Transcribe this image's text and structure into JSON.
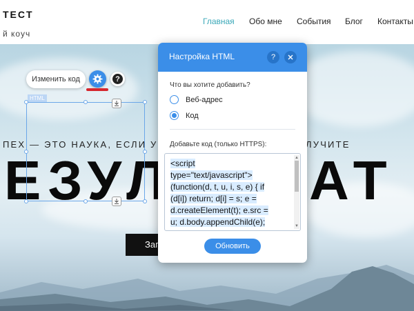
{
  "header": {
    "logo": "TECT",
    "tagline": "й коуч",
    "nav": [
      "Главная",
      "Обо мне",
      "События",
      "Блог",
      "Контакты"
    ]
  },
  "hero": {
    "line_left": "ПЕХ — ЭТО НАУКА, ЕСЛИ У В",
    "line_right": "ЛУЧИТЕ",
    "big_left": "ЕЗУЛ",
    "big_right": "АТ",
    "cta_label": "Зап"
  },
  "editor": {
    "edit_code_label": "Изменить код",
    "html_tag": "HTML"
  },
  "modal": {
    "title": "Настройка HTML",
    "question": "Что вы хотите добавить?",
    "options": [
      {
        "label": "Веб-адрес",
        "selected": false
      },
      {
        "label": "Код",
        "selected": true
      }
    ],
    "code_label": "Добавьте код (только HTTPS):",
    "code_lines": [
      "<script",
      "type=\"text/javascript\">",
      "(function(d, t, u, i, s, e) { if",
      "(d[i]) return; d[i] = s; e =",
      "d.createElement(t); e.src =",
      "u; d.body.appendChild(e);"
    ],
    "update_label": "Обновить"
  },
  "colors": {
    "accent": "#3b8ee8",
    "nav_active": "#3aa8b8",
    "highlight": "#d6262d"
  },
  "icons": [
    "gear-icon",
    "question-icon",
    "close-icon",
    "download-icon"
  ]
}
